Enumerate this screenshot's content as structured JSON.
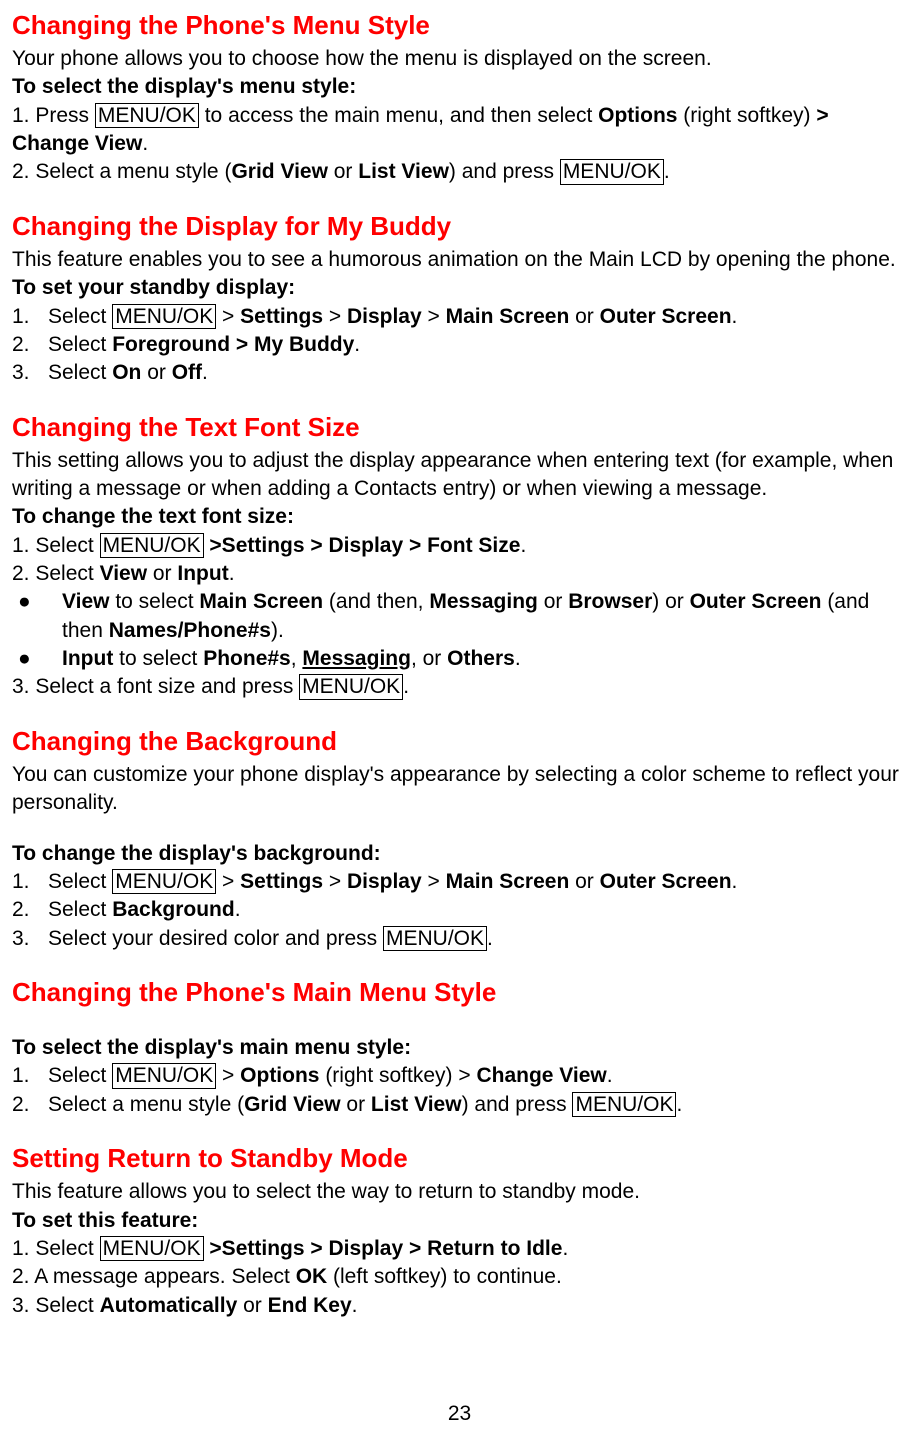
{
  "menuOk": "MENU/OK",
  "s1": {
    "heading": "Changing the Phone's Menu Style",
    "intro": "Your phone allows you to choose how the menu is displayed on the screen.",
    "subhead": "To select the display's menu style:",
    "step1_a": "1. Press ",
    "step1_b": " to access the main menu, and then select ",
    "step1_options": "Options",
    "step1_c": " (right softkey) ",
    "step1_gt": "> Change View",
    "step1_end": ".",
    "step2_a": "2. Select a menu style (",
    "step2_grid": "Grid View",
    "step2_or": " or ",
    "step2_list": "List View",
    "step2_b": ") and press ",
    "step2_end": "."
  },
  "s2": {
    "heading": "Changing the Display for My Buddy",
    "intro": "This feature enables you to see a humorous animation on the Main LCD by opening the phone.",
    "subhead": "To set your standby display:",
    "r1_a": "Select ",
    "r1_b": " > ",
    "r1_settings": "Settings",
    "r1_c": " > ",
    "r1_display": "Display",
    "r1_d": " > ",
    "r1_main": "Main Screen",
    "r1_or": " or ",
    "r1_outer": "Outer Screen",
    "r1_end": ".",
    "r2_a": "Select ",
    "r2_fg": "Foreground > My Buddy",
    "r2_end": ".",
    "r3_a": "Select ",
    "r3_on": "On",
    "r3_or": " or ",
    "r3_off": "Off",
    "r3_end": "."
  },
  "s3": {
    "heading": "Changing the Text Font Size",
    "intro": "This setting allows you to adjust the display appearance when entering text (for example, when writing a message or when adding a Contacts entry) or when viewing a message.",
    "subhead": "To change the text font size:",
    "step1_a": "1. Select ",
    "step1_b": " ",
    "step1_path": ">Settings > Display > Font Size",
    "step1_end": ".",
    "step2_a": "2. Select ",
    "step2_view": "View",
    "step2_or": " or ",
    "step2_input": "Input",
    "step2_end": ".",
    "b1_view": "View",
    "b1_a": " to select ",
    "b1_main": "Main Screen",
    "b1_b": " (and then, ",
    "b1_msg": "Messaging",
    "b1_or": " or ",
    "b1_browser": "Browser",
    "b1_c": ") or ",
    "b1_outer": "Outer Screen",
    "b1_d": " (and then ",
    "b1_names": "Names/Phone#s",
    "b1_e": ").",
    "b2_input": "Input",
    "b2_a": " to select ",
    "b2_phone": "Phone#s",
    "b2_c1": ", ",
    "b2_msg": "Messaging",
    "b2_c2": ", or ",
    "b2_others": "Others",
    "b2_end": ".",
    "step3_a": "3. Select a font size and press ",
    "step3_end": "."
  },
  "s4": {
    "heading": "Changing the Background",
    "intro": "You can customize your phone display's appearance by selecting a color scheme to reflect your personality.",
    "subhead": "To change the display's background:",
    "r1_a": "Select ",
    "r1_b": " > ",
    "r1_settings": "Settings",
    "r1_c": " > ",
    "r1_display": "Display",
    "r1_d": " > ",
    "r1_main": "Main Screen",
    "r1_or": " or ",
    "r1_outer": "Outer Screen",
    "r1_end": ".",
    "r2_a": "Select ",
    "r2_bg": "Background",
    "r2_end": ".",
    "r3_a": "Select your desired color and press ",
    "r3_end": "."
  },
  "s5": {
    "heading": "Changing the Phone's Main Menu Style",
    "subhead": "To select the display's main menu style:",
    "r1_a": "Select ",
    "r1_b": " > ",
    "r1_options": "Options",
    "r1_c": " (right softkey) > ",
    "r1_cv": "Change View",
    "r1_end": ".",
    "r2_a": "Select a menu style (",
    "r2_grid": "Grid View",
    "r2_or": " or ",
    "r2_list": "List View",
    "r2_b": ") and press ",
    "r2_end": "."
  },
  "s6": {
    "heading": "Setting Return to Standby Mode",
    "intro": "This feature allows you to select the way to return to standby mode.",
    "subhead": "To set this feature:",
    "step1_a": "1. Select ",
    "step1_b": " ",
    "step1_path": ">Settings > Display > Return to Idle",
    "step1_end": ".",
    "step2_a": "2. A message appears. Select ",
    "step2_ok": "OK",
    "step2_b": " (left softkey) to continue.",
    "step3_a": "3. Select ",
    "step3_auto": "Automatically",
    "step3_or": " or ",
    "step3_end": "End Key",
    "step3_dot": "."
  },
  "pageNumber": "23"
}
